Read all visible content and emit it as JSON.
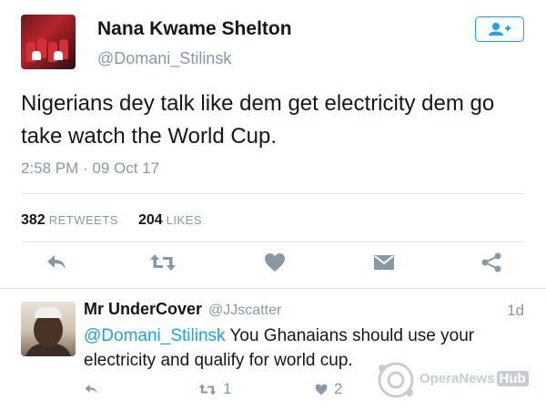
{
  "tweet": {
    "author_name": "Nana Kwame Shelton",
    "author_handle": "@Domani_Stilinsk",
    "text": "Nigerians dey talk like dem get electricity dem go take watch the World Cup.",
    "timestamp": "2:58 PM · 09 Oct 17",
    "retweets_count": "382",
    "retweets_label": "RETWEETS",
    "likes_count": "204",
    "likes_label": "LIKES"
  },
  "reply": {
    "author_name": "Mr UnderCover",
    "author_handle": "@JJscatter",
    "age": "1d",
    "mention": "@Domani_Stilinsk",
    "text": " You Ghanaians should use your electricity and qualify for world cup.",
    "retweet_count": "1",
    "like_count": "2"
  },
  "watermark": {
    "brand": "OperaNews",
    "hub": "Hub"
  },
  "colors": {
    "accent": "#1da1f2",
    "muted": "#8899a6",
    "icon": "#8899a6"
  },
  "icons": [
    "follow-user-icon",
    "reply-icon",
    "retweet-icon",
    "like-icon",
    "direct-message-icon",
    "share-icon"
  ]
}
